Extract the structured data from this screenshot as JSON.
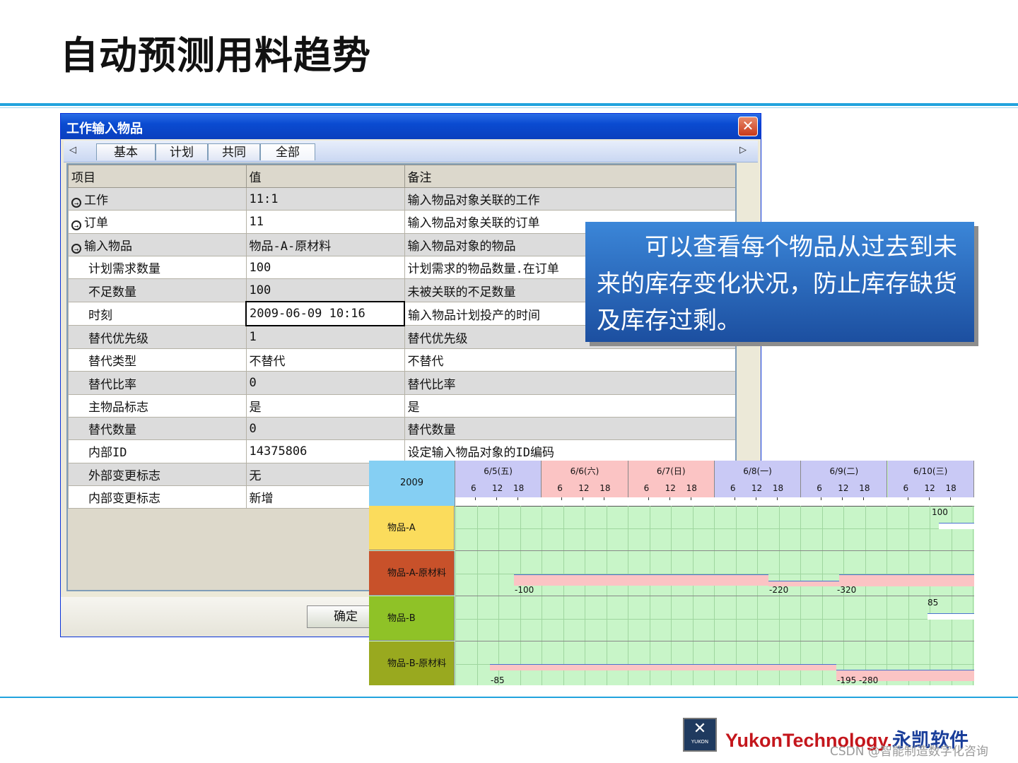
{
  "slide": {
    "title": "自动预测用料趋势"
  },
  "dialog": {
    "title": "工作输入物品",
    "close_label": "✕",
    "tabs": [
      "基本",
      "计划",
      "共同",
      "全部"
    ],
    "tab_left_arrow": "◁",
    "tab_right_arrow": "▷",
    "columns": [
      "项目",
      "值",
      "备注"
    ],
    "rows": [
      {
        "icon": true,
        "item": "工作",
        "value": "11:1",
        "note": "输入物品对象关联的工作"
      },
      {
        "icon": true,
        "item": "订单",
        "value": "11",
        "note": "输入物品对象关联的订单"
      },
      {
        "icon": true,
        "item": "输入物品",
        "value": "物品-A-原材料",
        "note": "输入物品对象的物品"
      },
      {
        "icon": false,
        "item": "计划需求数量",
        "value": "100",
        "note": "计划需求的物品数量.在订单"
      },
      {
        "icon": false,
        "item": "不足数量",
        "value": "100",
        "note": "未被关联的不足数量"
      },
      {
        "icon": false,
        "item": "时刻",
        "value": "2009-06-09 10:16",
        "note": "输入物品计划投产的时间"
      },
      {
        "icon": false,
        "item": "替代优先级",
        "value": "1",
        "note": "替代优先级"
      },
      {
        "icon": false,
        "item": "替代类型",
        "value": "不替代",
        "note": "不替代"
      },
      {
        "icon": false,
        "item": "替代比率",
        "value": "0",
        "note": "替代比率"
      },
      {
        "icon": false,
        "item": "主物品标志",
        "value": "是",
        "note": "是"
      },
      {
        "icon": false,
        "item": "替代数量",
        "value": "0",
        "note": "替代数量"
      },
      {
        "icon": false,
        "item": "内部ID",
        "value": "14375806",
        "note": "设定输入物品对象的ID编码"
      },
      {
        "icon": false,
        "item": "外部变更标志",
        "value": "无",
        "note": ""
      },
      {
        "icon": false,
        "item": "内部变更标志",
        "value": "新增",
        "note": ""
      }
    ],
    "ok_label": "确定"
  },
  "callout": {
    "text": "可以查看每个物品从过去到未来的库存变化状况，防止库存缺货及库存过剩。"
  },
  "gantt": {
    "year": "2009",
    "days": [
      {
        "label": "6/5(五)",
        "color": "#c9c9f5"
      },
      {
        "label": "6/6(六)",
        "color": "#fbc4c4"
      },
      {
        "label": "6/7(日)",
        "color": "#fbc4c4"
      },
      {
        "label": "6/8(一)",
        "color": "#c9c9f5"
      },
      {
        "label": "6/9(二)",
        "color": "#c9c9f5"
      },
      {
        "label": "6/10(三)",
        "color": "#c9c9f5"
      }
    ],
    "hours": [
      "6",
      "12",
      "18"
    ],
    "items": [
      {
        "label": "物品-A",
        "color": "#fbdc5c"
      },
      {
        "label": "物品-A-原材料",
        "color": "#c8512a"
      },
      {
        "label": "物品-B",
        "color": "#8fc227"
      },
      {
        "label": "物品-B-原材料",
        "color": "#99a91f"
      }
    ],
    "value_labels": {
      "a_pos": "100",
      "araw_1": "-100",
      "araw_2": "-220",
      "araw_3": "-320",
      "b_pos": "85",
      "braw_1": "-85",
      "braw_2": "-195",
      "braw_3": "-280"
    }
  },
  "footer": {
    "logo_text": "YUKON",
    "brand_en": "YukonTechnology.",
    "brand_cn": "永凯软件",
    "watermark": "CSDN @智能制造数字化咨询"
  }
}
